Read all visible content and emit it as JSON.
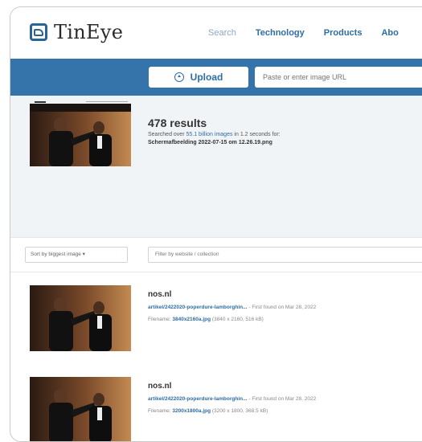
{
  "header": {
    "logo_text": "TinEye",
    "nav": [
      "Search",
      "Technology",
      "Products",
      "Abo"
    ]
  },
  "searchbar": {
    "upload_label": "Upload",
    "url_placeholder": "Paste or enter image URL"
  },
  "query": {
    "count": "478 results",
    "line1_prefix": "Searched over",
    "line1_link": "55.1 billion images",
    "line1_suffix": "in 1.2 seconds for:",
    "filename": "Schermafbeelding 2022-07-15 om 12.26.19.png"
  },
  "filters": {
    "sort_label": "Sort by biggest image ▾",
    "filter_placeholder": "Filter by website / collection"
  },
  "results": [
    {
      "domain": "nos.nl",
      "link": "artikel/2422020-poperdure-lamborghin...",
      "first_found": "- First found on Mar 28, 2022",
      "file_label": "Filename:",
      "file_name": "3840x2160a.jpg",
      "file_meta": "(3840 x 2160, 516 kB)"
    },
    {
      "domain": "nos.nl",
      "link": "artikel/2422020-poperdure-lamborghin...",
      "first_found": "- First found on Mar 28, 2022",
      "file_label": "Filename:",
      "file_name": "3200x1800a.jpg",
      "file_meta": "(3200 x 1800, 368.5 kB)"
    }
  ],
  "icons": {
    "logo": "tineye-logo-icon",
    "upload": "upload-icon"
  },
  "colors": {
    "brand_blue": "#3573ab",
    "link_blue": "#2f6da3",
    "panel_bg": "#f1f4f7"
  }
}
